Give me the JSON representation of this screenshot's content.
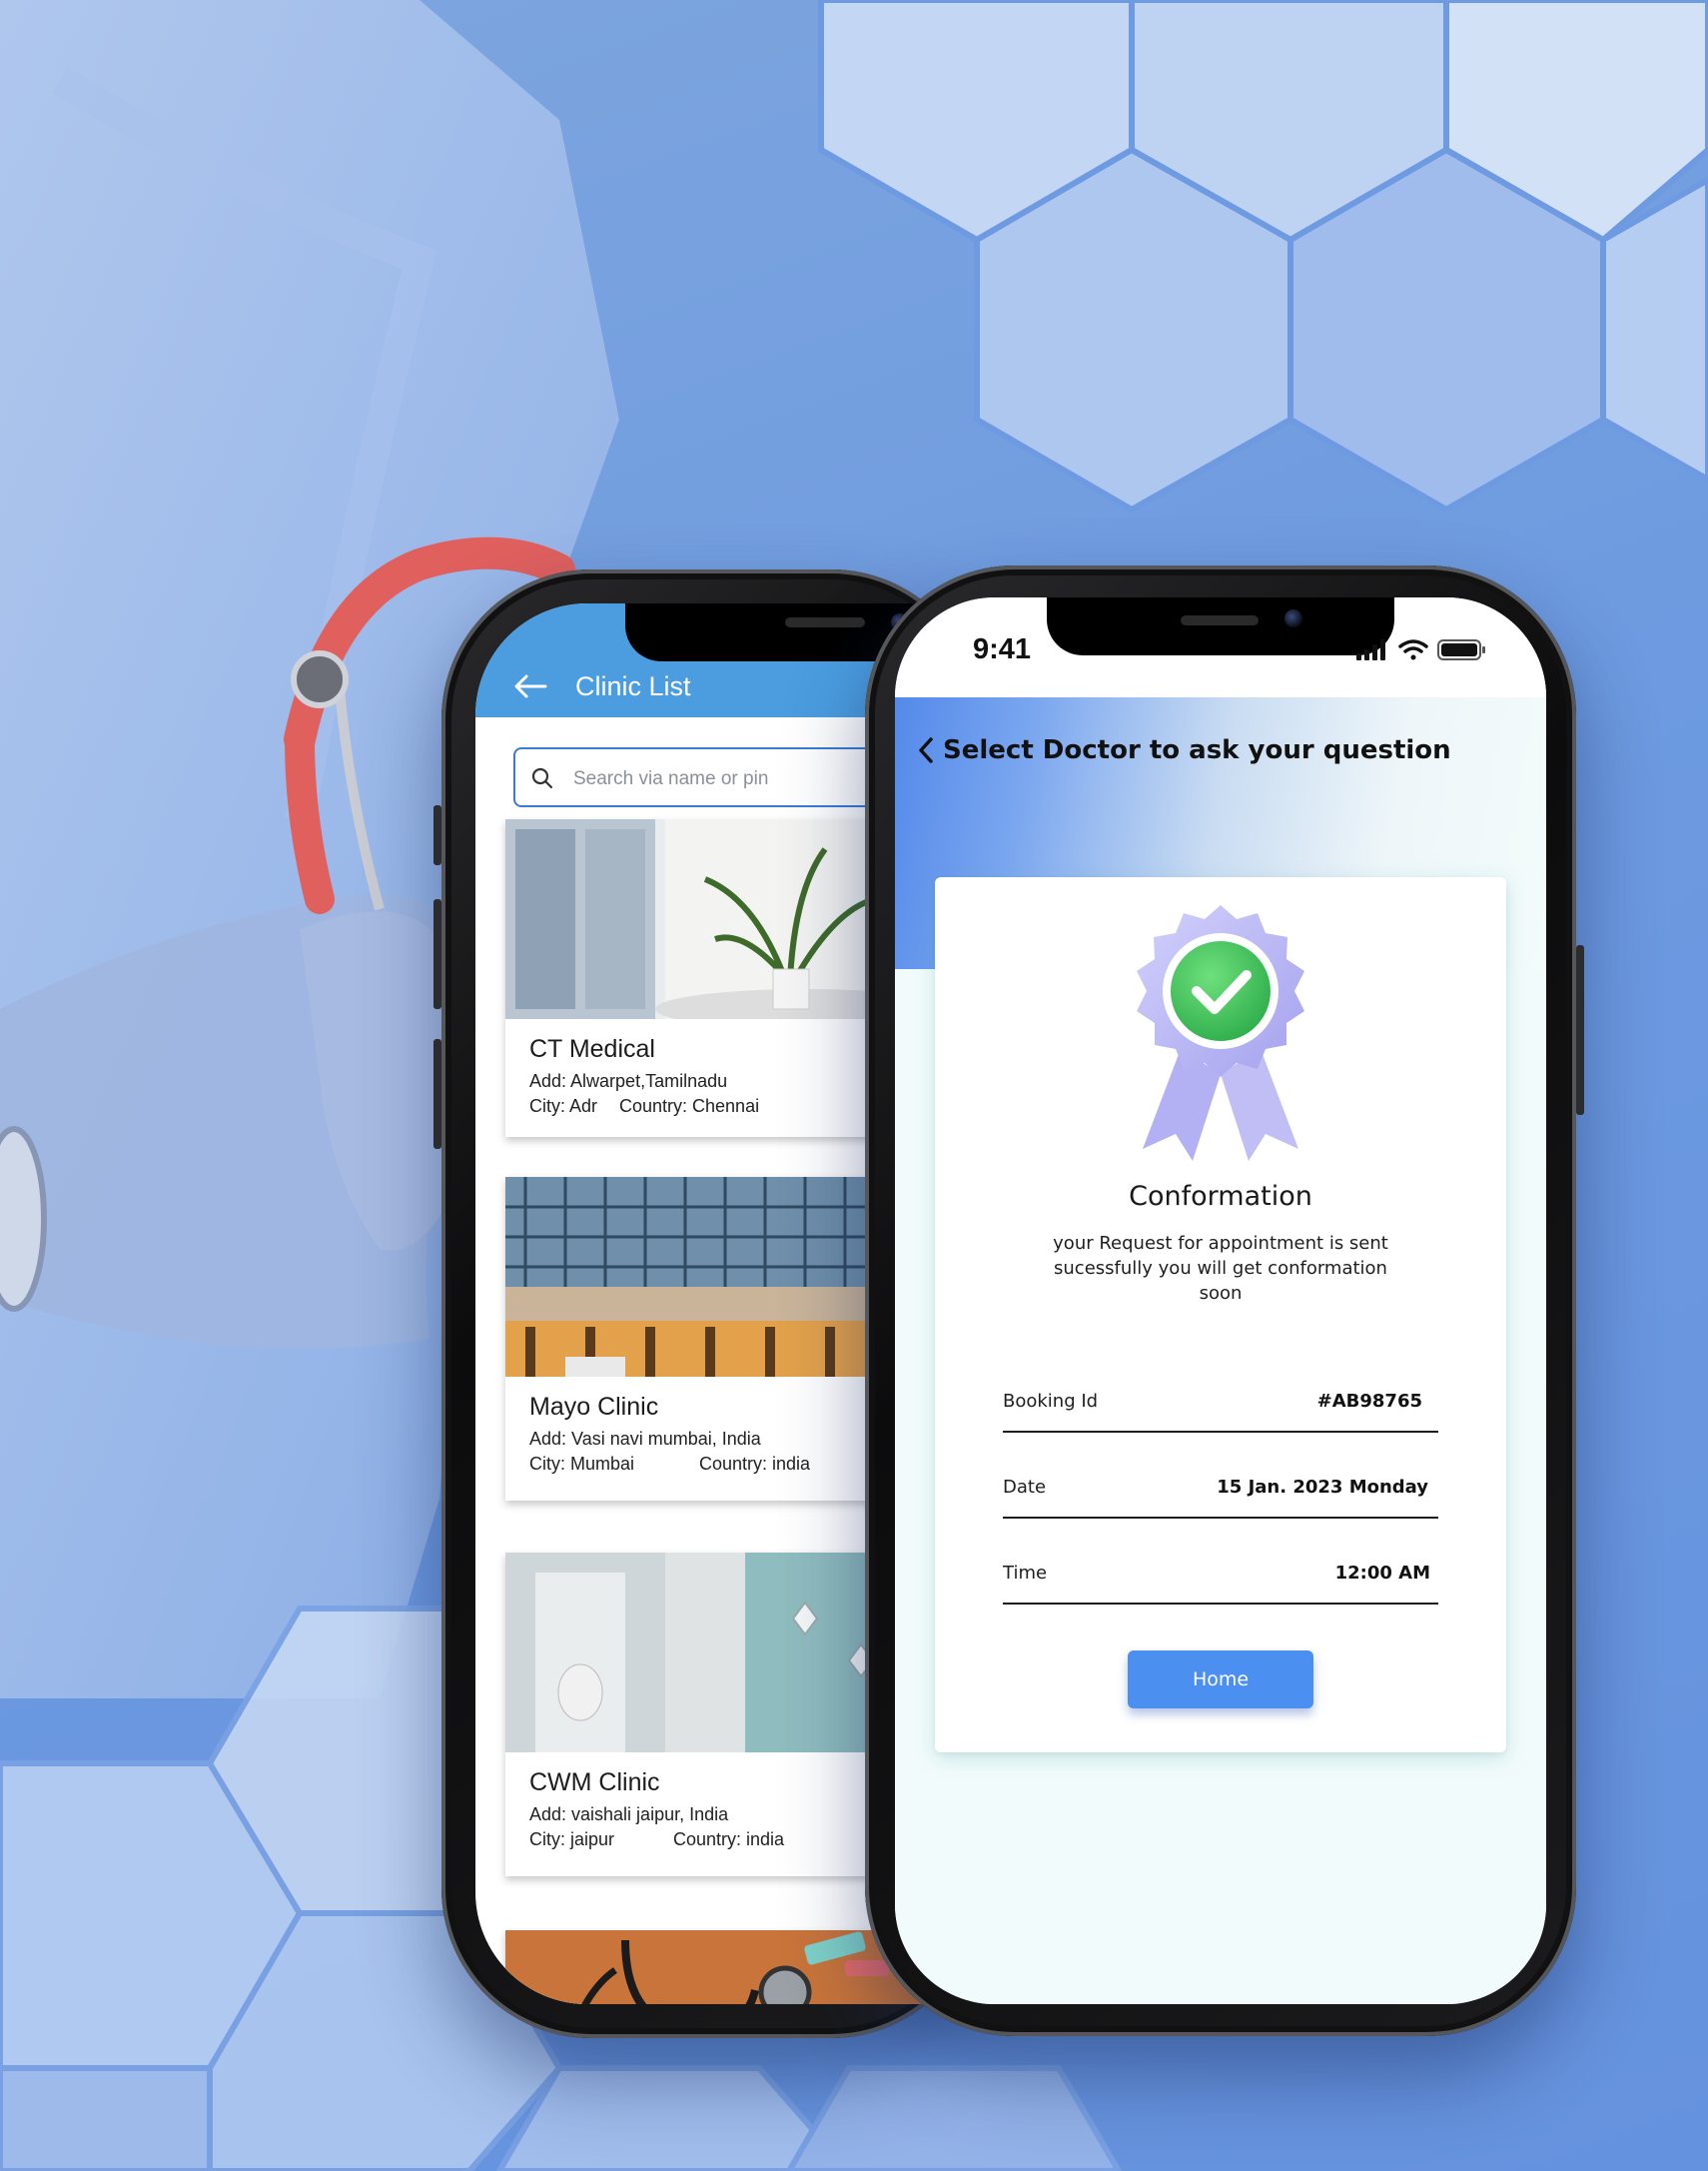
{
  "clinic_app": {
    "title": "Clinic List",
    "search": {
      "placeholder": "Search via name or pin"
    },
    "clinics": [
      {
        "name": "CT Medical",
        "address": "Add: Alwarpet,Tamilnadu",
        "city": "City: Adr",
        "country": "Country: Chennai"
      },
      {
        "name": "Mayo Clinic",
        "address": "Add: Vasi navi mumbai, India",
        "city": "City: Mumbai",
        "country": "Country: india"
      },
      {
        "name": "CWM Clinic",
        "address": "Add: vaishali jaipur, India",
        "city": "City: jaipur",
        "country": "Country: india"
      }
    ]
  },
  "confirm_app": {
    "status_time": "9:41",
    "title": "Select Doctor to ask your question",
    "heading": "Conformation",
    "message": "your Request for appointment is sent sucessfully you will get conformation soon",
    "details": [
      {
        "label": "Booking Id",
        "value": "#AB98765"
      },
      {
        "label": "Date",
        "value": "15 Jan. 2023 Monday"
      },
      {
        "label": "Time",
        "value": "12:00 AM"
      }
    ],
    "home_button": "Home"
  },
  "colors": {
    "background": "#6d9ae0",
    "clinic_header": "#4b9de0",
    "primary_button": "#4b8ff0",
    "check_green": "#3cc25a",
    "badge_lavender": "#b9b7f5"
  },
  "icons": [
    "back-arrow-icon",
    "search-icon",
    "chevron-left-icon",
    "signal-icon",
    "wifi-icon",
    "battery-icon",
    "verified-badge-icon"
  ]
}
